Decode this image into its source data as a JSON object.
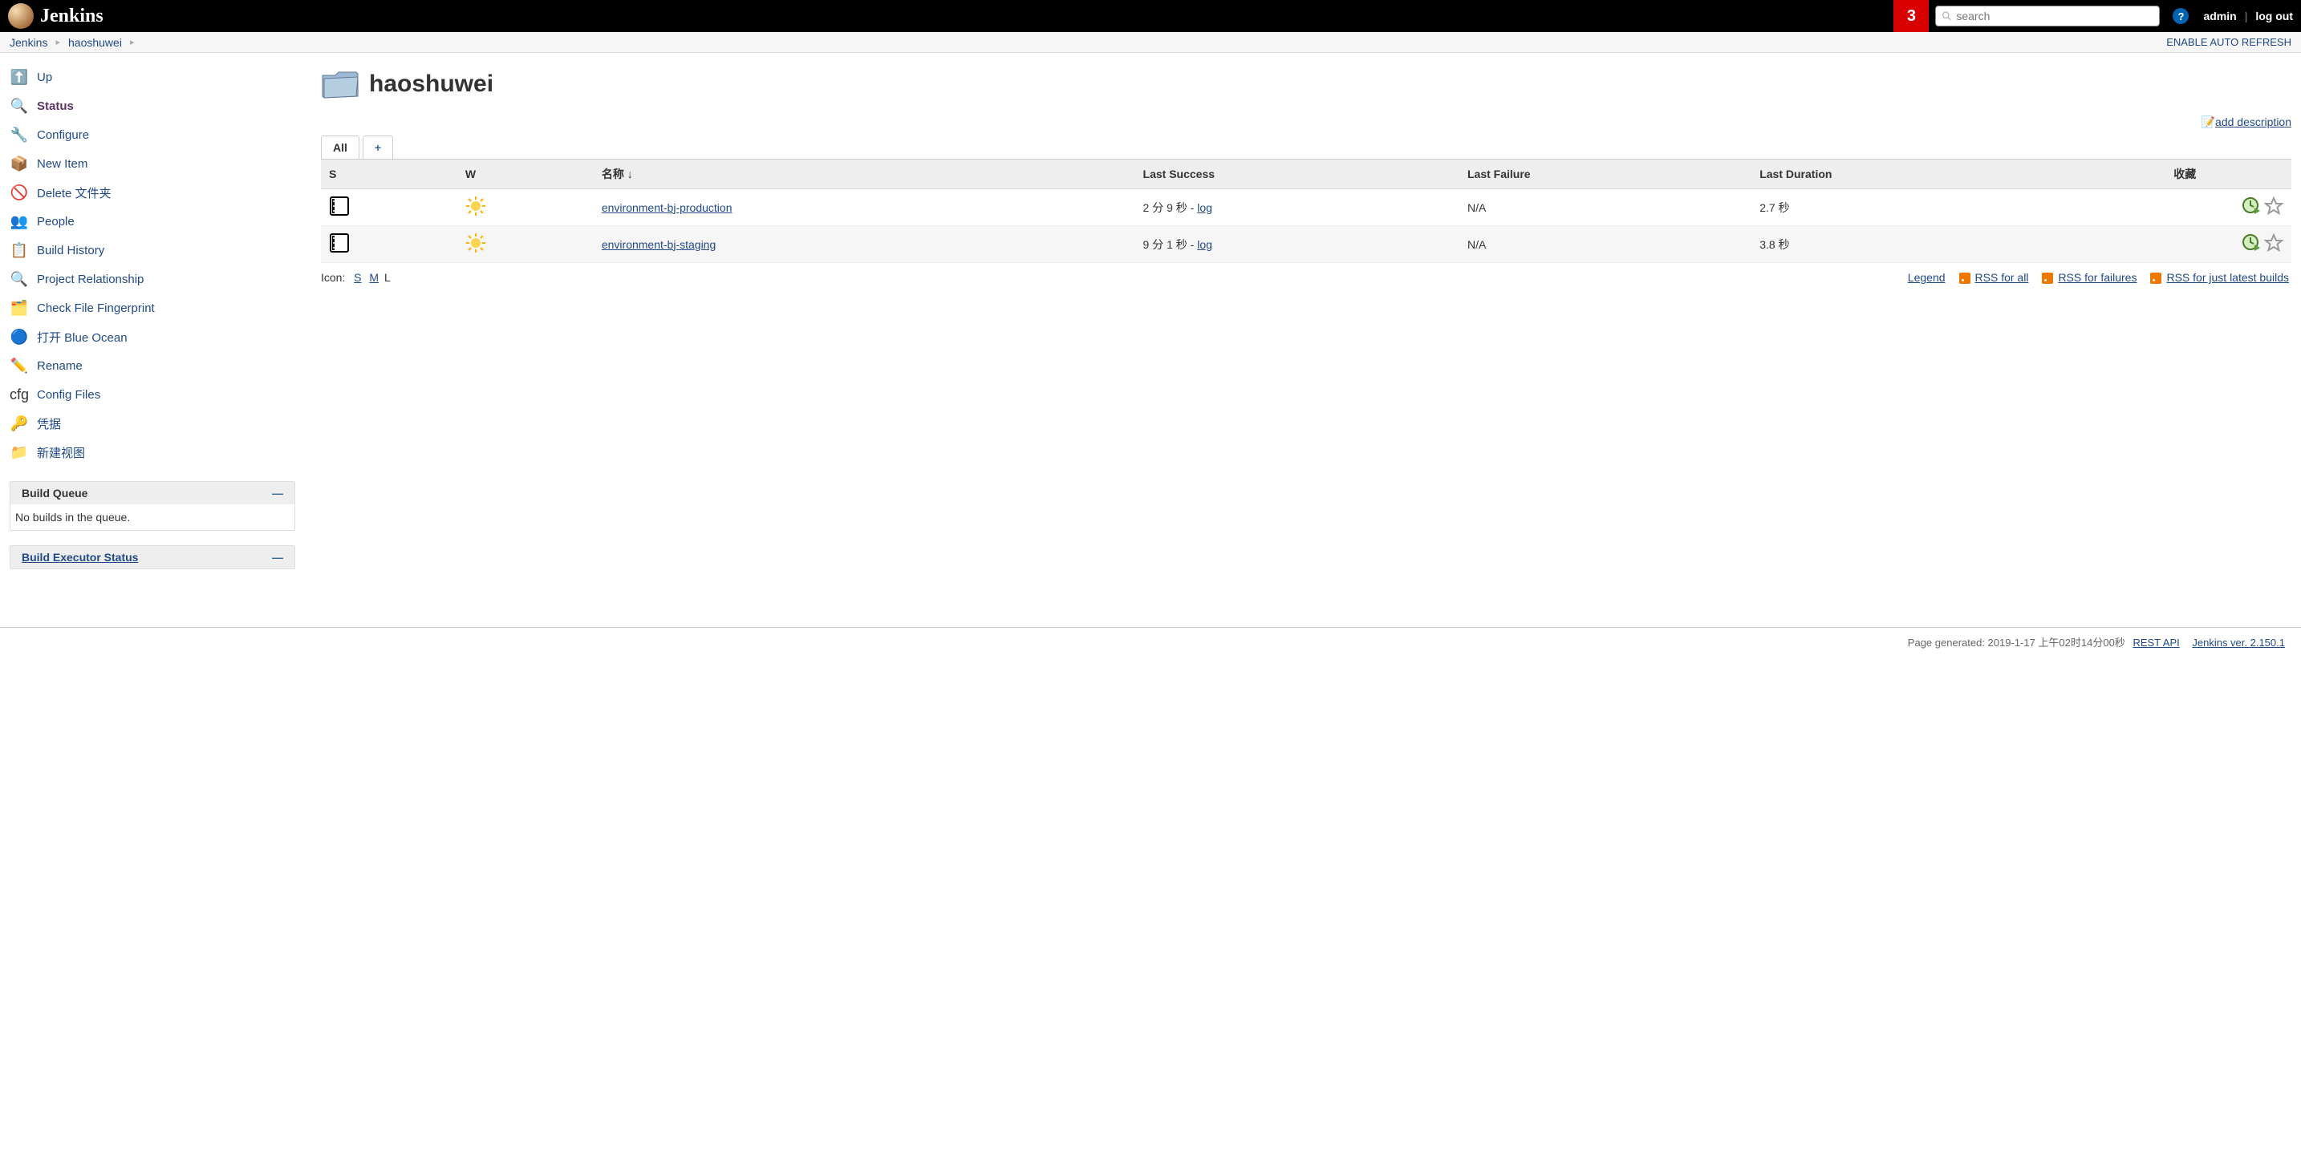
{
  "header": {
    "brand": "Jenkins",
    "notification_count": "3",
    "search_placeholder": "search",
    "user": "admin",
    "logout": "log out"
  },
  "breadcrumb": {
    "items": [
      "Jenkins",
      "haoshuwei"
    ],
    "auto_refresh": "ENABLE AUTO REFRESH"
  },
  "sidebar": {
    "tasks": [
      {
        "label": "Up",
        "icon": "up-icon"
      },
      {
        "label": "Status",
        "icon": "status-icon",
        "active": true
      },
      {
        "label": "Configure",
        "icon": "configure-icon"
      },
      {
        "label": "New Item",
        "icon": "new-item-icon"
      },
      {
        "label": "Delete 文件夹",
        "icon": "delete-icon"
      },
      {
        "label": "People",
        "icon": "people-icon"
      },
      {
        "label": "Build History",
        "icon": "history-icon"
      },
      {
        "label": "Project Relationship",
        "icon": "relationship-icon"
      },
      {
        "label": "Check File Fingerprint",
        "icon": "fingerprint-icon"
      },
      {
        "label": "打开 Blue Ocean",
        "icon": "blue-ocean-icon"
      },
      {
        "label": "Rename",
        "icon": "rename-icon"
      },
      {
        "label": "Config Files",
        "icon": "config-files-icon"
      },
      {
        "label": "凭据",
        "icon": "credentials-icon"
      },
      {
        "label": "新建视图",
        "icon": "new-view-icon"
      }
    ],
    "build_queue": {
      "title": "Build Queue",
      "empty_text": "No builds in the queue."
    },
    "executor": {
      "title": "Build Executor Status"
    }
  },
  "main": {
    "title": "haoshuwei",
    "add_description": "add description",
    "tabs": {
      "all": "All",
      "plus": "+"
    },
    "columns": {
      "s": "S",
      "w": "W",
      "name": "名称 ↓",
      "last_success": "Last Success",
      "last_failure": "Last Failure",
      "last_duration": "Last Duration",
      "fav": "收藏"
    },
    "rows": [
      {
        "name": "environment-bj-production",
        "last_success": "2 分 9 秒 - ",
        "log": "log",
        "last_failure": "N/A",
        "last_duration": "2.7 秒"
      },
      {
        "name": "environment-bj-staging",
        "last_success": "9 分 1 秒 - ",
        "log": "log",
        "last_failure": "N/A",
        "last_duration": "3.8 秒"
      }
    ],
    "icon_label": "Icon:",
    "icon_sizes": {
      "s": "S",
      "m": "M",
      "l": "L"
    },
    "legend": "Legend",
    "rss": {
      "all": "RSS for all",
      "failures": "RSS for failures",
      "latest": "RSS for just latest builds"
    }
  },
  "footer": {
    "generated": "Page generated: 2019-1-17 上午02时14分00秒",
    "rest_api": "REST API",
    "version": "Jenkins ver. 2.150.1"
  }
}
